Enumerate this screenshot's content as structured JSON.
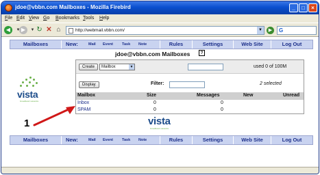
{
  "window": {
    "title": "jdoe@vbbn.com Mailboxes - Mozilla Firebird"
  },
  "menu": {
    "items": [
      "File",
      "Edit",
      "View",
      "Go",
      "Bookmarks",
      "Tools",
      "Help"
    ]
  },
  "url": "http://webmail.vbbn.com/",
  "nav": {
    "mailboxes": "Mailboxes",
    "new": "New:",
    "new_items": [
      "Mail",
      "Event",
      "Task",
      "Note"
    ],
    "rules": "Rules",
    "settings": "Settings",
    "website": "Web Site",
    "logout": "Log Out"
  },
  "heading": "jdoe@vbbn.com Mailboxes",
  "help_glyph": "?",
  "create_button": "Create",
  "type_select": "Mailbox",
  "usage": "used 0 of 100M",
  "display_button": "Display",
  "filter_label": "Filter:",
  "selected_count": "2 selected",
  "columns": {
    "mailbox": "Mailbox",
    "size": "Size",
    "messages": "Messages",
    "new": "New",
    "unread": "Unread"
  },
  "rows": [
    {
      "name": "Inbox",
      "size": "0",
      "messages": "0"
    },
    {
      "name": "SPAM",
      "size": "0",
      "messages": "0"
    }
  ],
  "logo": {
    "word": "vista",
    "tagline": "broadband networks"
  },
  "annotation": "1"
}
